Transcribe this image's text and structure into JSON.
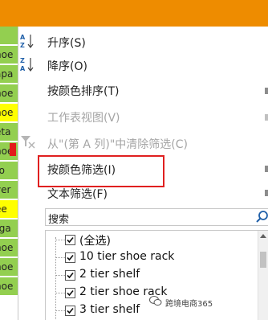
{
  "sheet": {
    "cells": [
      {
        "text": "r",
        "color": "green"
      },
      {
        "text": "hoe",
        "color": "green"
      },
      {
        "text": "apa",
        "color": "green"
      },
      {
        "text": "hoe",
        "color": "green"
      },
      {
        "text": "hoe",
        "color": "yellow"
      },
      {
        "text": "eta",
        "color": "green"
      },
      {
        "text": "hoe",
        "color": "green"
      },
      {
        "text": "ro",
        "color": "green"
      },
      {
        "text": "ver",
        "color": "green"
      },
      {
        "text": "ee",
        "color": "yellow"
      },
      {
        "text": "rga",
        "color": "green"
      },
      {
        "text": "hoe",
        "color": "green"
      },
      {
        "text": "hoe",
        "color": "green"
      },
      {
        "text": "hoe",
        "color": "green"
      }
    ]
  },
  "menu": {
    "sort_asc": "升序(S)",
    "sort_desc": "降序(O)",
    "sort_by_color": "按颜色排序(T)",
    "sheet_view": "工作表视图(V)",
    "clear_filter": "从\"(第 A 列)\"中清除筛选(C)",
    "filter_by_color": "按颜色筛选(I)",
    "text_filter": "文本筛选(F)"
  },
  "search": {
    "placeholder": "搜索"
  },
  "filter_list": [
    {
      "label": "(全选)",
      "checked": true
    },
    {
      "label": "10 tier shoe rack",
      "checked": true
    },
    {
      "label": "2 tier shelf",
      "checked": true
    },
    {
      "label": "2 tier shoe rack",
      "checked": true
    },
    {
      "label": "3 tier shelf",
      "checked": true
    }
  ],
  "watermark": {
    "text": "跨境电商365"
  },
  "colors": {
    "accent_bar": "#ee8c00",
    "highlight": "#e02020",
    "cell_green": "#93cf50",
    "cell_yellow": "#ffff00"
  }
}
